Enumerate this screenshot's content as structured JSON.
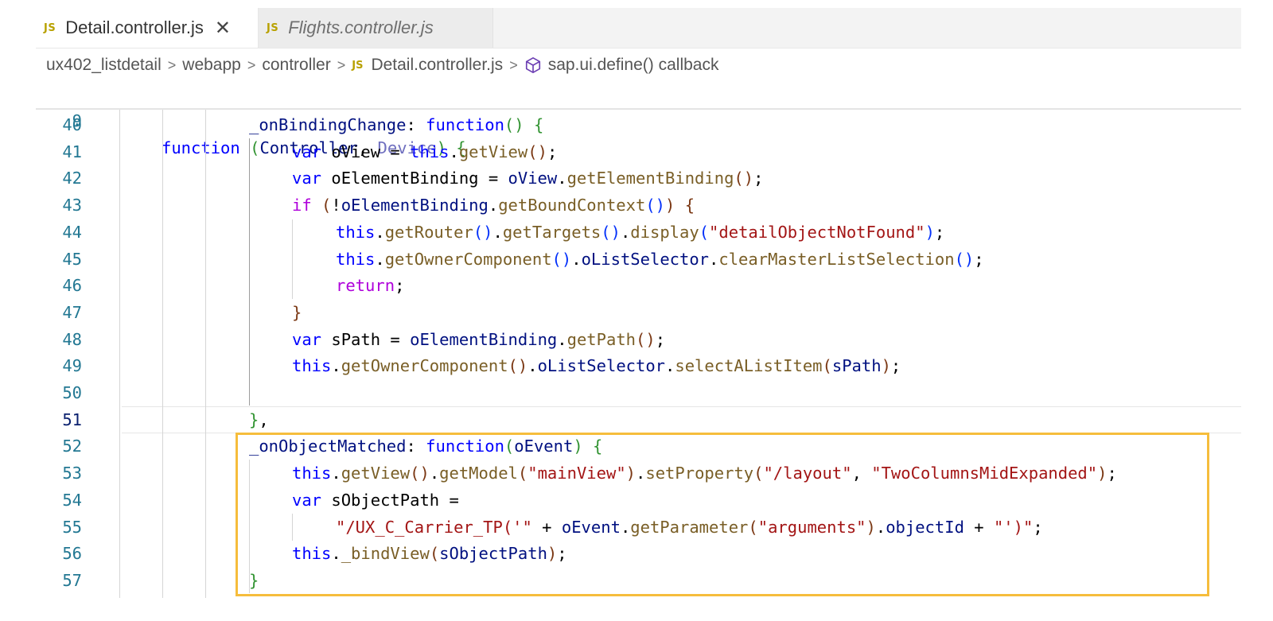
{
  "tabs": [
    {
      "badge": "JS",
      "label": "Detail.controller.js",
      "close": "✕",
      "active": true
    },
    {
      "badge": "JS",
      "label": "Flights.controller.js",
      "active": false
    }
  ],
  "breadcrumb": {
    "items": [
      "ux402_listdetail",
      "webapp",
      "controller"
    ],
    "file_badge": "JS",
    "file": "Detail.controller.js",
    "symbol": "sap.ui.define() callback",
    "separator": ">"
  },
  "editor": {
    "sticky": {
      "number": "9",
      "tokens": [
        {
          "t": "function",
          "c": "kw"
        },
        {
          "t": " ",
          "c": "pl"
        },
        {
          "t": "(",
          "c": "b2"
        },
        {
          "t": "Controller",
          "c": "id"
        },
        {
          "t": ", ",
          "c": "pl"
        },
        {
          "t": "Device",
          "c": "param"
        },
        {
          "t": ")",
          "c": "b2"
        },
        {
          "t": " ",
          "c": "pl"
        },
        {
          "t": "{",
          "c": "b2"
        }
      ]
    },
    "lines": [
      {
        "number": "40",
        "tokens": [
          {
            "t": "_onBindingChange",
            "c": "id"
          },
          {
            "t": ": ",
            "c": "pl"
          },
          {
            "t": "function",
            "c": "kw"
          },
          {
            "t": "()",
            "c": "b2"
          },
          {
            "t": " ",
            "c": "pl"
          },
          {
            "t": "{",
            "c": "b2"
          }
        ]
      },
      {
        "number": "41",
        "tokens": [
          {
            "t": "var",
            "c": "kw"
          },
          {
            "t": " oView = ",
            "c": "pl"
          },
          {
            "t": "this",
            "c": "kw"
          },
          {
            "t": ".",
            "c": "pl"
          },
          {
            "t": "getView",
            "c": "fn"
          },
          {
            "t": "()",
            "c": "b3"
          },
          {
            "t": ";",
            "c": "pl"
          }
        ]
      },
      {
        "number": "42",
        "tokens": [
          {
            "t": "var",
            "c": "kw"
          },
          {
            "t": " oElementBinding = ",
            "c": "pl"
          },
          {
            "t": "oView",
            "c": "id"
          },
          {
            "t": ".",
            "c": "pl"
          },
          {
            "t": "getElementBinding",
            "c": "fn"
          },
          {
            "t": "()",
            "c": "b3"
          },
          {
            "t": ";",
            "c": "pl"
          }
        ]
      },
      {
        "number": "43",
        "tokens": [
          {
            "t": "if",
            "c": "ctl"
          },
          {
            "t": " ",
            "c": "pl"
          },
          {
            "t": "(",
            "c": "b3"
          },
          {
            "t": "!",
            "c": "pl"
          },
          {
            "t": "oElementBinding",
            "c": "id"
          },
          {
            "t": ".",
            "c": "pl"
          },
          {
            "t": "getBoundContext",
            "c": "fn"
          },
          {
            "t": "()",
            "c": "b1"
          },
          {
            "t": ")",
            "c": "b3"
          },
          {
            "t": " ",
            "c": "pl"
          },
          {
            "t": "{",
            "c": "b3"
          }
        ]
      },
      {
        "number": "44",
        "tokens": [
          {
            "t": "this",
            "c": "kw"
          },
          {
            "t": ".",
            "c": "pl"
          },
          {
            "t": "getRouter",
            "c": "fn"
          },
          {
            "t": "()",
            "c": "b1"
          },
          {
            "t": ".",
            "c": "pl"
          },
          {
            "t": "getTargets",
            "c": "fn"
          },
          {
            "t": "()",
            "c": "b1"
          },
          {
            "t": ".",
            "c": "pl"
          },
          {
            "t": "display",
            "c": "fn"
          },
          {
            "t": "(",
            "c": "b1"
          },
          {
            "t": "\"detailObjectNotFound\"",
            "c": "str"
          },
          {
            "t": ")",
            "c": "b1"
          },
          {
            "t": ";",
            "c": "pl"
          }
        ]
      },
      {
        "number": "45",
        "tokens": [
          {
            "t": "this",
            "c": "kw"
          },
          {
            "t": ".",
            "c": "pl"
          },
          {
            "t": "getOwnerComponent",
            "c": "fn"
          },
          {
            "t": "()",
            "c": "b1"
          },
          {
            "t": ".",
            "c": "pl"
          },
          {
            "t": "oListSelector",
            "c": "id"
          },
          {
            "t": ".",
            "c": "pl"
          },
          {
            "t": "clearMasterListSelection",
            "c": "fn"
          },
          {
            "t": "()",
            "c": "b1"
          },
          {
            "t": ";",
            "c": "pl"
          }
        ]
      },
      {
        "number": "46",
        "tokens": [
          {
            "t": "return",
            "c": "ctl"
          },
          {
            "t": ";",
            "c": "pl"
          }
        ]
      },
      {
        "number": "47",
        "tokens": [
          {
            "t": "}",
            "c": "b3"
          }
        ]
      },
      {
        "number": "48",
        "tokens": [
          {
            "t": "var",
            "c": "kw"
          },
          {
            "t": " sPath = ",
            "c": "pl"
          },
          {
            "t": "oElementBinding",
            "c": "id"
          },
          {
            "t": ".",
            "c": "pl"
          },
          {
            "t": "getPath",
            "c": "fn"
          },
          {
            "t": "()",
            "c": "b3"
          },
          {
            "t": ";",
            "c": "pl"
          }
        ]
      },
      {
        "number": "49",
        "tokens": [
          {
            "t": "this",
            "c": "kw"
          },
          {
            "t": ".",
            "c": "pl"
          },
          {
            "t": "getOwnerComponent",
            "c": "fn"
          },
          {
            "t": "()",
            "c": "b3"
          },
          {
            "t": ".",
            "c": "pl"
          },
          {
            "t": "oListSelector",
            "c": "id"
          },
          {
            "t": ".",
            "c": "pl"
          },
          {
            "t": "selectAListItem",
            "c": "fn"
          },
          {
            "t": "(",
            "c": "b3"
          },
          {
            "t": "sPath",
            "c": "id"
          },
          {
            "t": ")",
            "c": "b3"
          },
          {
            "t": ";",
            "c": "pl"
          }
        ]
      },
      {
        "number": "50",
        "tokens": []
      },
      {
        "number": "51",
        "current": true,
        "tokens": [
          {
            "t": "}",
            "c": "b2"
          },
          {
            "t": ",",
            "c": "pl"
          }
        ]
      },
      {
        "number": "52",
        "tokens": [
          {
            "t": "_onObjectMatched",
            "c": "id"
          },
          {
            "t": ": ",
            "c": "pl"
          },
          {
            "t": "function",
            "c": "kw"
          },
          {
            "t": "(",
            "c": "b2"
          },
          {
            "t": "oEvent",
            "c": "id"
          },
          {
            "t": ")",
            "c": "b2"
          },
          {
            "t": " ",
            "c": "pl"
          },
          {
            "t": "{",
            "c": "b2"
          }
        ]
      },
      {
        "number": "53",
        "tokens": [
          {
            "t": "this",
            "c": "kw"
          },
          {
            "t": ".",
            "c": "pl"
          },
          {
            "t": "getView",
            "c": "fn"
          },
          {
            "t": "()",
            "c": "b3"
          },
          {
            "t": ".",
            "c": "pl"
          },
          {
            "t": "getModel",
            "c": "fn"
          },
          {
            "t": "(",
            "c": "b3"
          },
          {
            "t": "\"mainView\"",
            "c": "str"
          },
          {
            "t": ")",
            "c": "b3"
          },
          {
            "t": ".",
            "c": "pl"
          },
          {
            "t": "setProperty",
            "c": "fn"
          },
          {
            "t": "(",
            "c": "b3"
          },
          {
            "t": "\"/layout\"",
            "c": "str"
          },
          {
            "t": ", ",
            "c": "pl"
          },
          {
            "t": "\"TwoColumnsMidExpanded\"",
            "c": "str"
          },
          {
            "t": ")",
            "c": "b3"
          },
          {
            "t": ";",
            "c": "pl"
          }
        ]
      },
      {
        "number": "54",
        "tokens": [
          {
            "t": "var",
            "c": "kw"
          },
          {
            "t": " sObjectPath =",
            "c": "pl"
          }
        ]
      },
      {
        "number": "55",
        "tokens": [
          {
            "t": "\"/UX_C_Carrier_TP('\"",
            "c": "str"
          },
          {
            "t": " + ",
            "c": "pl"
          },
          {
            "t": "oEvent",
            "c": "id"
          },
          {
            "t": ".",
            "c": "pl"
          },
          {
            "t": "getParameter",
            "c": "fn"
          },
          {
            "t": "(",
            "c": "b3"
          },
          {
            "t": "\"arguments\"",
            "c": "str"
          },
          {
            "t": ")",
            "c": "b3"
          },
          {
            "t": ".",
            "c": "pl"
          },
          {
            "t": "objectId",
            "c": "id"
          },
          {
            "t": " + ",
            "c": "pl"
          },
          {
            "t": "\"')\"",
            "c": "str"
          },
          {
            "t": ";",
            "c": "pl"
          }
        ]
      },
      {
        "number": "56",
        "tokens": [
          {
            "t": "this",
            "c": "kw"
          },
          {
            "t": ".",
            "c": "pl"
          },
          {
            "t": "_bindView",
            "c": "fn"
          },
          {
            "t": "(",
            "c": "b3"
          },
          {
            "t": "sObjectPath",
            "c": "id"
          },
          {
            "t": ")",
            "c": "b3"
          },
          {
            "t": ";",
            "c": "pl"
          }
        ]
      },
      {
        "number": "57",
        "tokens": [
          {
            "t": "}",
            "c": "b2"
          }
        ]
      }
    ]
  },
  "colors": {
    "highlight_border": "#f6bd3c",
    "keyword": "#0000ff",
    "string": "#a31515",
    "function": "#795e26",
    "identifier": "#001080"
  }
}
